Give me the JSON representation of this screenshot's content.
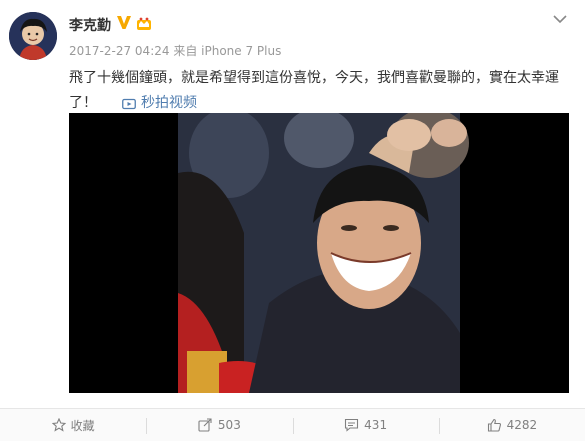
{
  "post": {
    "username": "李克勤",
    "timestamp": "2017-2-27 04:24",
    "source": "来自 iPhone 7 Plus",
    "text_line1": "飛了十幾個鐘頭，就是希望得到這份喜悅，今天，我們喜歡曼聯的，實在太幸運",
    "text_line2": "了！",
    "video_link_label": "秒拍视频"
  },
  "actions": {
    "favorite_label": "收藏",
    "repost_count": "503",
    "comment_count": "431",
    "like_count": "4282"
  },
  "icons": {
    "verified": "verified-v-badge-icon",
    "member": "crown-member-icon",
    "menu": "chevron-down-icon",
    "video": "video-play-icon",
    "favorite": "star-icon",
    "repost": "repost-icon",
    "comment": "comment-icon",
    "like": "thumbs-up-icon"
  },
  "colors": {
    "link": "#507daf",
    "verified": "#f6a800",
    "text": "#333333",
    "meta": "#999999"
  }
}
